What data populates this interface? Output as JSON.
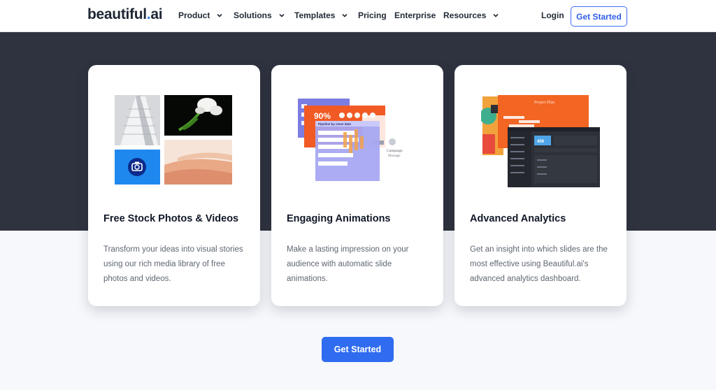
{
  "nav": {
    "logo_main": "beautiful",
    "logo_dot": ".",
    "logo_ai": "ai",
    "items": [
      {
        "label": "Product",
        "dropdown": true
      },
      {
        "label": "Solutions",
        "dropdown": true
      },
      {
        "label": "Templates",
        "dropdown": true
      },
      {
        "label": "Pricing",
        "dropdown": false
      },
      {
        "label": "Enterprise",
        "dropdown": false
      },
      {
        "label": "Resources",
        "dropdown": true
      }
    ],
    "login": "Login",
    "cta": "Get Started"
  },
  "cards": [
    {
      "title": "Free Stock Photos & Videos",
      "description": "Transform your ideas into visual stories using our rich media library of free photos and videos.",
      "icon": "photo-collage-illustration"
    },
    {
      "title": "Engaging Animations",
      "description": "Make a lasting impression on your audience with automatic slide animations.",
      "icon": "animated-slides-illustration"
    },
    {
      "title": "Advanced Analytics",
      "description": "Get an insight into which slides are the most effective using Beautiful.ai's advanced analytics dashboard.",
      "icon": "analytics-dashboard-illustration"
    }
  ],
  "illustration_text": {
    "percent": "90%",
    "pipeline": "Pipeline by close date",
    "campaign_title": "Campaign",
    "campaign_sub": "Message",
    "project_plan": "Project Plan",
    "analytics_value": "459"
  },
  "main_cta": "Get Started",
  "colors": {
    "brand_blue": "#2f6cf0",
    "dark_band": "#2f333f",
    "orange": "#f05a24",
    "purple": "#7f7fe0"
  }
}
